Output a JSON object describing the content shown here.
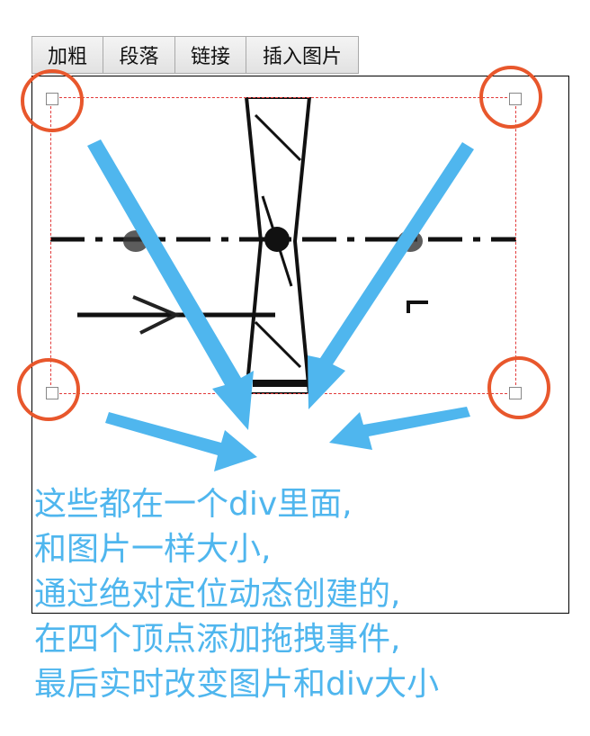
{
  "toolbar": {
    "bold_label": "加粗",
    "paragraph_label": "段落",
    "link_label": "链接",
    "insert_image_label": "插入图片"
  },
  "caption": {
    "line1": "这些都在一个div里面,",
    "line2": "和图片一样大小,",
    "line3": "通过绝对定位动态创建的,",
    "line4": "在四个顶点添加拖拽事件,",
    "line5": "最后实时改变图片和div大小"
  },
  "colors": {
    "arrow": "#4fb6ee",
    "highlight_circle": "#e8572c",
    "selection_border": "#e23b3b",
    "caption_text": "#4fb6ee"
  }
}
